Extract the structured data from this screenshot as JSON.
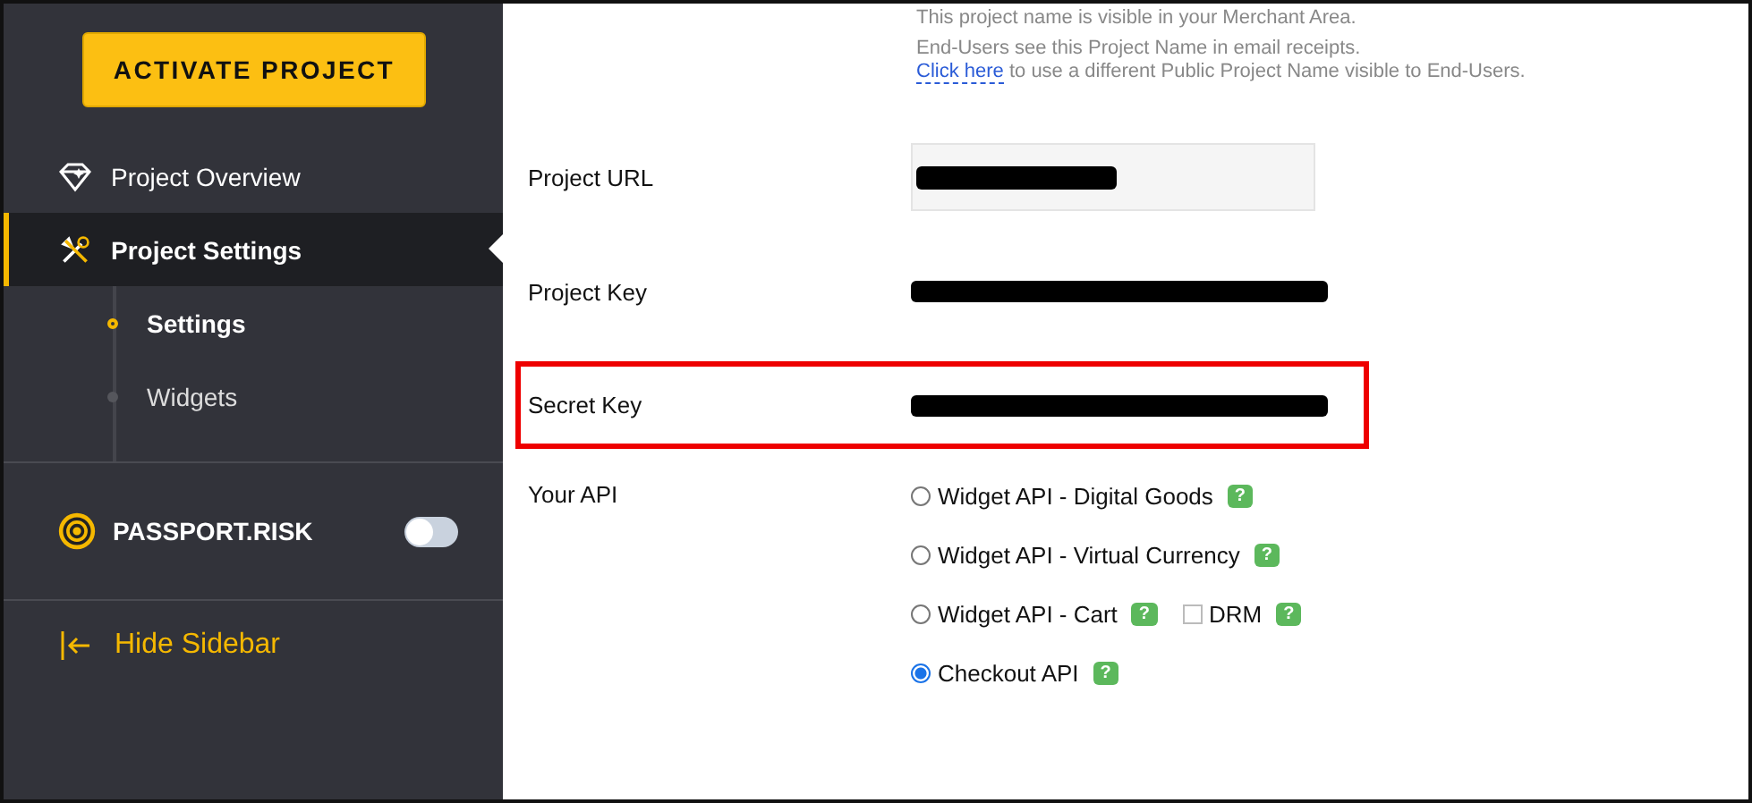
{
  "sidebar": {
    "activate_button": "ACTIVATE PROJECT",
    "nav": [
      {
        "label": "Project Overview",
        "kind": "overview",
        "selected": false
      },
      {
        "label": "Project Settings",
        "kind": "settings",
        "selected": true,
        "children": [
          {
            "label": "Settings",
            "selected": true
          },
          {
            "label": "Widgets",
            "selected": false
          }
        ]
      }
    ],
    "passport_risk": {
      "label": "PASSPORT.RISK",
      "on": false
    },
    "hide_sidebar": "Hide Sidebar"
  },
  "main": {
    "notes": [
      "This project name is visible in your Merchant Area.",
      "End-Users see this Project Name in email receipts."
    ],
    "link": {
      "label": "Click here",
      "rest": "to use a different Public Project Name visible to End-Users."
    },
    "fields": [
      {
        "label": "Project URL",
        "kind": "input",
        "highlighted": false
      },
      {
        "label": "Project Key",
        "kind": "redacted",
        "highlighted": false
      },
      {
        "label": "Secret Key",
        "kind": "redacted",
        "highlighted": true
      }
    ],
    "api": {
      "label": "Your API",
      "options": [
        {
          "label": "Widget API - Digital Goods",
          "selected": false
        },
        {
          "label": "Widget API - Virtual Currency",
          "selected": false
        },
        {
          "label": "Widget API - Cart",
          "selected": false,
          "extras": [
            {
              "label": "DRM",
              "checked": false
            }
          ]
        },
        {
          "label": "Checkout API",
          "selected": true
        }
      ],
      "help": "?"
    }
  }
}
